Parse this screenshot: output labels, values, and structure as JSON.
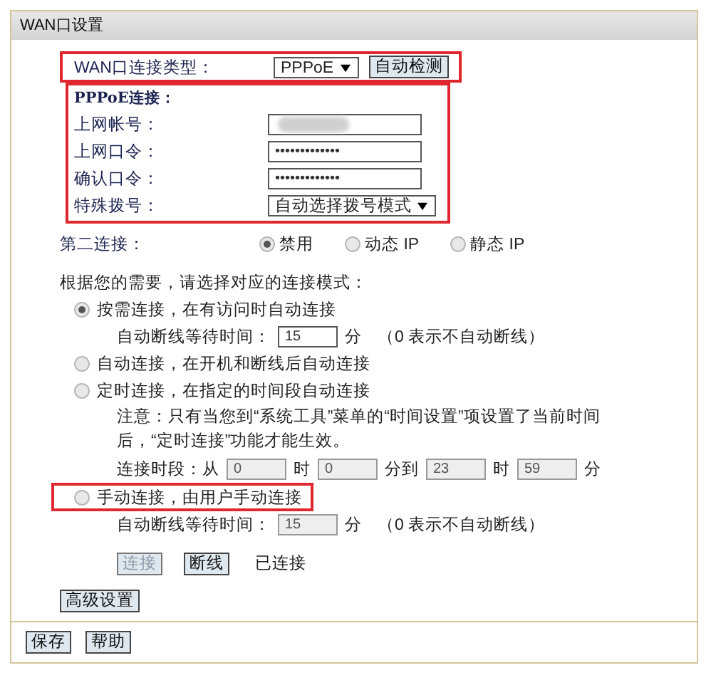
{
  "window": {
    "title": "WAN口设置"
  },
  "wan_type": {
    "label": "WAN口连接类型：",
    "value": "PPPoE",
    "detect_button": "自动检测",
    "highlighted": true
  },
  "pppoe": {
    "heading": "PPPoE连接：",
    "highlighted": true,
    "fields": [
      {
        "kind": "redacted",
        "label": "上网帐号："
      },
      {
        "kind": "text",
        "label": "上网口令：",
        "value": "•••••••••••••"
      },
      {
        "kind": "text",
        "label": "确认口令：",
        "value": "•••••••••••••"
      },
      {
        "kind": "select",
        "label": "特殊拨号：",
        "value": "自动选择拨号模式"
      }
    ]
  },
  "second_connection": {
    "label": "第二连接：",
    "options": [
      {
        "label": "禁用",
        "selected": true
      },
      {
        "label": "动态 IP",
        "selected": false
      },
      {
        "label": "静态 IP",
        "selected": false
      }
    ]
  },
  "mode_prompt": "根据您的需要，请选择对应的连接模式：",
  "modes": [
    {
      "label": "按需连接，在有访问时自动连接",
      "selected": true,
      "highlighted": false,
      "wait": {
        "label": "自动断线等待时间：",
        "value": "15",
        "unit": "分",
        "note": "（0 表示不自动断线）",
        "disabled": false
      }
    },
    {
      "label": "自动连接，在开机和断线后自动连接",
      "selected": false,
      "highlighted": false
    },
    {
      "label": "定时连接，在指定的时间段自动连接",
      "selected": false,
      "highlighted": false,
      "note": "注意：只有当您到“系统工具”菜单的“时间设置”项设置了当前时间后，“定时连接”功能才能生效。",
      "time_range": {
        "label": "连接时段：从",
        "disabled": true,
        "parts": [
          {
            "value": "0",
            "unit": "时"
          },
          {
            "value": "0",
            "unit": "分到"
          },
          {
            "value": "23",
            "unit": "时"
          },
          {
            "value": "59",
            "unit": "分"
          }
        ]
      }
    },
    {
      "label": "手动连接，由用户手动连接",
      "selected": false,
      "highlighted": true,
      "wait": {
        "label": "自动断线等待时间：",
        "value": "15",
        "unit": "分",
        "note": "（0 表示不自动断线）",
        "disabled": true
      }
    }
  ],
  "connection_buttons": [
    {
      "label": "连接",
      "disabled": true
    },
    {
      "label": "断线",
      "disabled": false
    }
  ],
  "connection_status": "已连接",
  "advanced_button": "高级设置",
  "footer_buttons": [
    "保存",
    "帮助"
  ]
}
